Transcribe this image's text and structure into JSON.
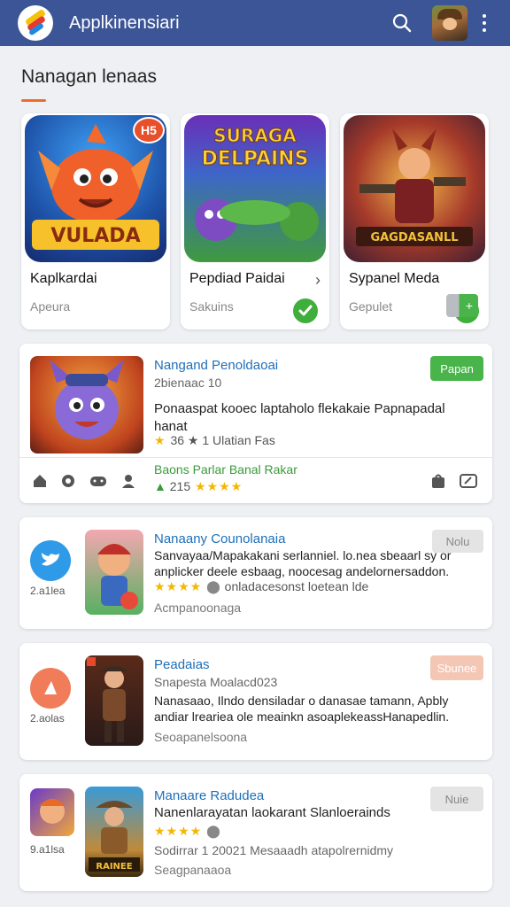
{
  "header": {
    "app_title": "Applkinensiari"
  },
  "section": {
    "title": "Nanagan lenaas"
  },
  "featured": [
    {
      "name": "Kaplkardai",
      "sub": "Apeura",
      "badge": "H5",
      "art_text": "VULADA",
      "icon": "chevron-right-icon"
    },
    {
      "name": "Pepdiad Paidai",
      "sub": "Sakuins",
      "art_text": "SURAGA DELPAINS",
      "chev": "›"
    },
    {
      "name": "Sypanel Meda",
      "sub": "Gepulet",
      "art_text": "GAGDASANLL"
    }
  ],
  "cards": [
    {
      "title": "Nangand Penoldaoai",
      "meta": "2bienaac 10",
      "desc": "Ponaaspat kooec laptaholo flekakaie Papnapadal hanat",
      "rating_text": "36 ★ 1 Ulatian Fas",
      "button": "Papan",
      "footer_title": "Baons Parlar Banal Rakar",
      "footer_count": "215",
      "colors": {
        "button": "#48b44a"
      }
    },
    {
      "title": "Nanaany Counolanaia",
      "desc": "Sanvayaa/Mapakakani serlanniel. lo.nea sbeaarl sy or anplicker deele esbaag, noocesag andelornersaddon.",
      "rating_text": "onladacesonst loetean lde",
      "foot": "Acmpanoonaga",
      "side_label": "2.a1lea",
      "button": "Nolu",
      "colors": {
        "side": "#2f9be8"
      }
    },
    {
      "title": "Peadaias",
      "meta": "Snapesta  Moalacd023",
      "desc": "Nanasaao, Ilndo densiladar o danasae tamann, Apbly andiar lreariea ole meainkn asoaplekeassHanapedlin.",
      "foot": "Seoapanelsoona",
      "side_label": "2.aolas",
      "button": "Sbunee",
      "colors": {
        "side": "#f07c5a",
        "button": "#f4c6b4"
      }
    },
    {
      "title": "Manaare Radudea",
      "desc": "Nanenlarayatan laokarant Slanloerainds",
      "meta": "Sodirrar 1 20021 Mesaaadh atapolrernidmy",
      "foot": "Seagpanaaoa",
      "side_label": "9.a1lsa",
      "button": "Nuie",
      "thumb_text": "RAINEE"
    }
  ]
}
